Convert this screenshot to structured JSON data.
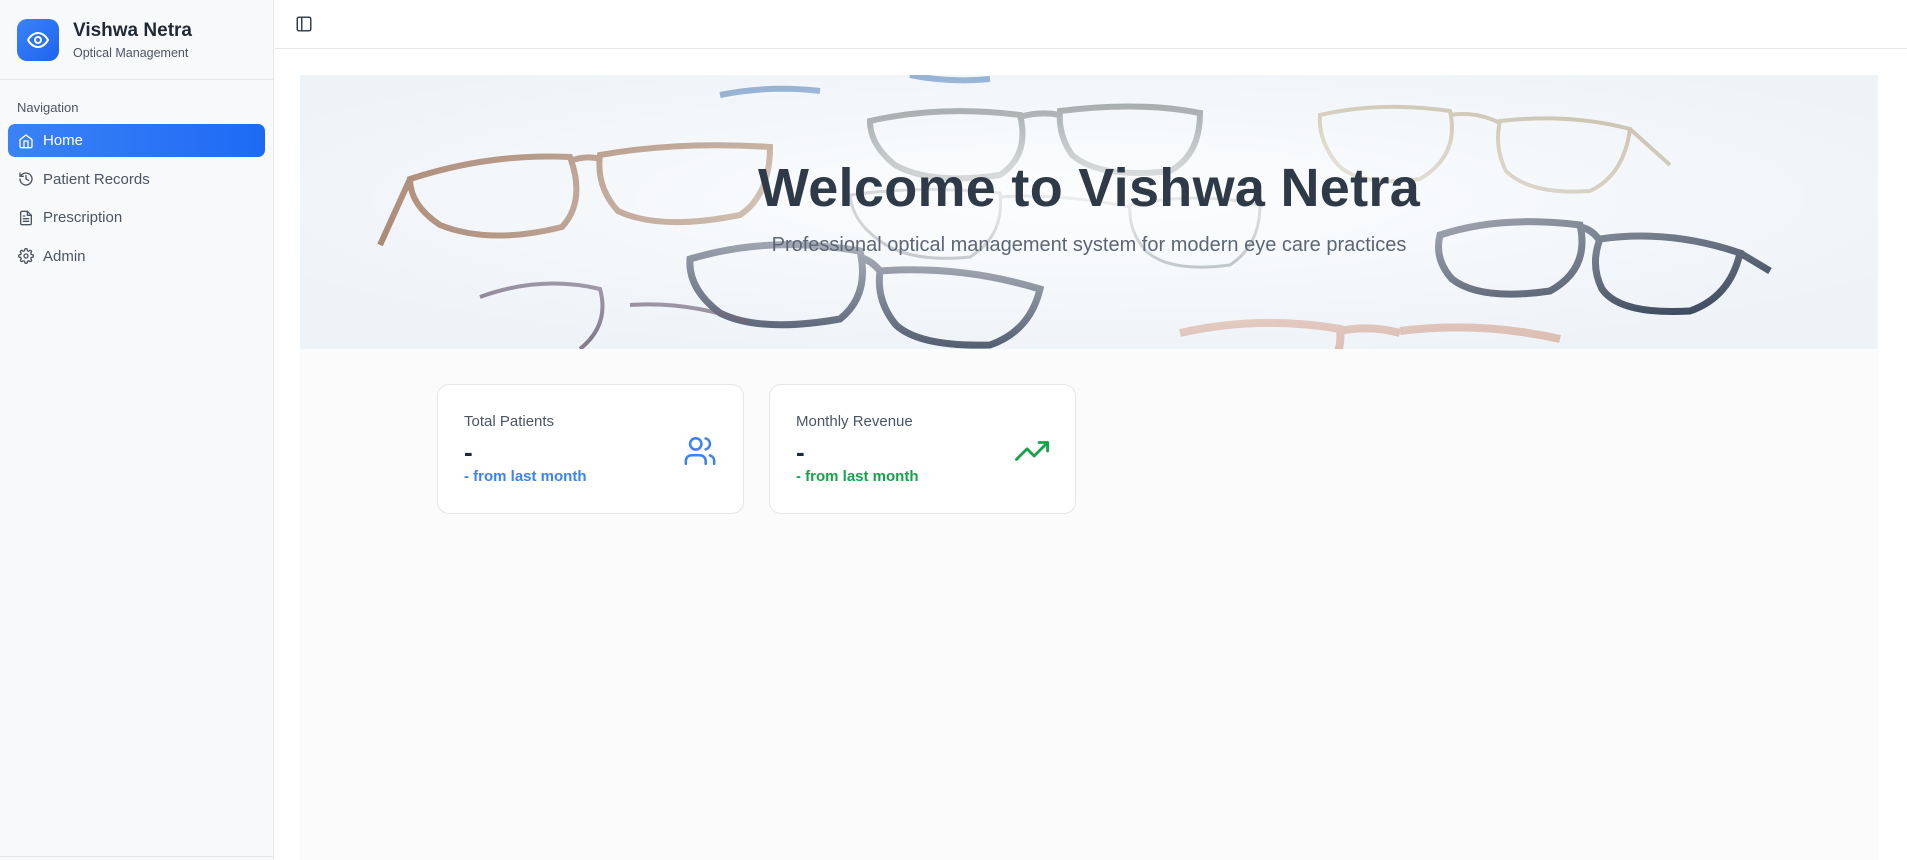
{
  "brand": {
    "name": "Vishwa Netra",
    "subtitle": "Optical Management",
    "logo_icon": "eye-icon"
  },
  "sidebar": {
    "group_label": "Navigation",
    "items": [
      {
        "label": "Home",
        "icon": "home-icon",
        "active": true
      },
      {
        "label": "Patient Records",
        "icon": "history-icon",
        "active": false
      },
      {
        "label": "Prescription",
        "icon": "file-text-icon",
        "active": false
      },
      {
        "label": "Admin",
        "icon": "gear-icon",
        "active": false
      }
    ]
  },
  "topbar": {
    "toggle_icon": "sidebar-toggle-icon"
  },
  "hero": {
    "title": "Welcome to Vishwa Netra",
    "subtitle": "Professional optical management system for modern eye care practices"
  },
  "stats": [
    {
      "title": "Total Patients",
      "value": "-",
      "change": "- from last month",
      "color": "#3b82f6",
      "icon": "users-icon"
    },
    {
      "title": "Monthly Revenue",
      "value": "-",
      "change": "- from last month",
      "color": "#16a34a",
      "icon": "trending-up-icon"
    }
  ],
  "colors": {
    "primary": "#2563eb",
    "success": "#16a34a",
    "sidebar_bg": "#f8f9fa"
  }
}
